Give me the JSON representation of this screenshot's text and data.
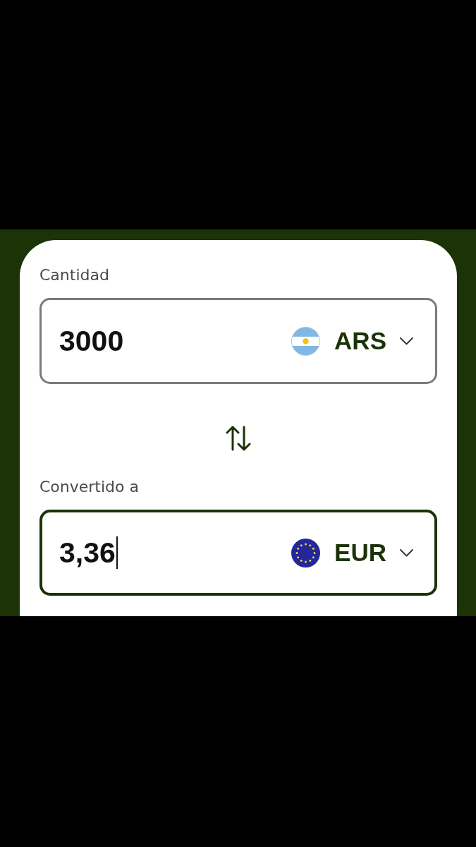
{
  "fields": [
    {
      "label": "Cantidad",
      "value": "3000",
      "focused": false,
      "currency": {
        "code": "ARS",
        "kind": "argentina"
      }
    },
    {
      "label": "Convertido a",
      "value": "3,36",
      "focused": true,
      "currency": {
        "code": "EUR",
        "kind": "europe"
      }
    }
  ]
}
